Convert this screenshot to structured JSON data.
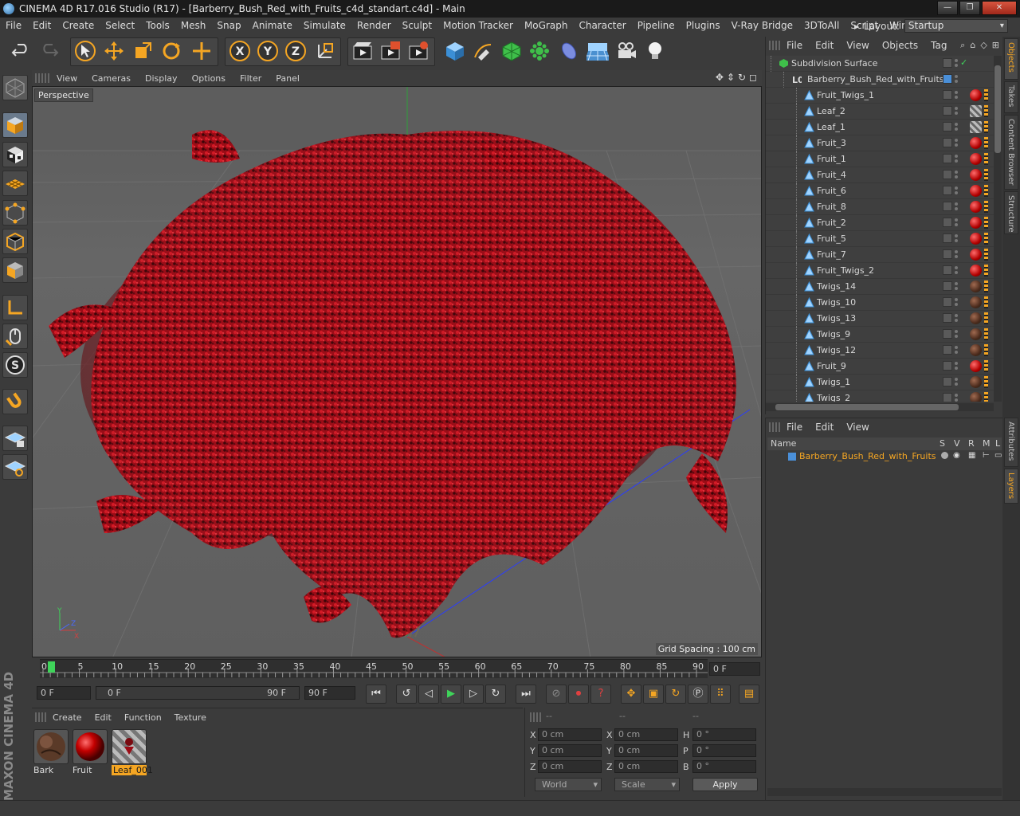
{
  "window": {
    "title": "CINEMA 4D R17.016 Studio (R17) - [Barberry_Bush_Red_with_Fruits_c4d_standart.c4d] - Main",
    "minimize": "—",
    "maximize": "❐",
    "close": "✕"
  },
  "menubar": {
    "items": [
      "File",
      "Edit",
      "Create",
      "Select",
      "Tools",
      "Mesh",
      "Snap",
      "Animate",
      "Simulate",
      "Render",
      "Sculpt",
      "Motion Tracker",
      "MoGraph",
      "Character",
      "Pipeline",
      "Plugins",
      "V-Ray Bridge",
      "3DToAll",
      "Script",
      "Window"
    ],
    "layout_label": "Layout:",
    "layout_value": "Startup"
  },
  "toolbar": {
    "axis_x": "X",
    "axis_y": "Y",
    "axis_z": "Z"
  },
  "viewport": {
    "menu": [
      "View",
      "Cameras",
      "Display",
      "Options",
      "Filter",
      "Panel"
    ],
    "label": "Perspective",
    "grid_spacing": "Grid Spacing : 100 cm"
  },
  "timeline": {
    "ticks": [
      "0",
      "5",
      "10",
      "15",
      "20",
      "25",
      "30",
      "35",
      "40",
      "45",
      "50",
      "55",
      "60",
      "65",
      "70",
      "75",
      "80",
      "85",
      "90"
    ],
    "current_frame": "0 F"
  },
  "transport": {
    "start_field": "0 F",
    "range_start": "0 F",
    "range_end": "90 F",
    "end_field": "90 F"
  },
  "material_manager": {
    "menu": [
      "Create",
      "Edit",
      "Function",
      "Texture"
    ],
    "materials": [
      {
        "name": "Bark",
        "selected": false
      },
      {
        "name": "Fruit",
        "selected": false
      },
      {
        "name": "Leaf_001",
        "selected": true
      }
    ]
  },
  "coordinates": {
    "col_headers": [
      "--",
      "--",
      "--"
    ],
    "rows": [
      {
        "l1": "X",
        "v1": "0 cm",
        "l2": "X",
        "v2": "0 cm",
        "l3": "H",
        "v3": "0 °"
      },
      {
        "l1": "Y",
        "v1": "0 cm",
        "l2": "Y",
        "v2": "0 cm",
        "l3": "P",
        "v3": "0 °"
      },
      {
        "l1": "Z",
        "v1": "0 cm",
        "l2": "Z",
        "v2": "0 cm",
        "l3": "B",
        "v3": "0 °"
      }
    ],
    "space_select": "World",
    "mode_select": "Scale",
    "apply": "Apply"
  },
  "object_manager": {
    "menu": [
      "File",
      "Edit",
      "View",
      "Objects",
      "Tag"
    ],
    "objects": [
      {
        "name": "Subdivision Surface",
        "level": 0,
        "tag": "none"
      },
      {
        "name": "Barberry_Bush_Red_with_Fruits",
        "level": 1,
        "tag": "layer"
      },
      {
        "name": "Fruit_Twigs_1",
        "level": 2,
        "tag": "fruit"
      },
      {
        "name": "Leaf_2",
        "level": 2,
        "tag": "leaf"
      },
      {
        "name": "Leaf_1",
        "level": 2,
        "tag": "leaf"
      },
      {
        "name": "Fruit_3",
        "level": 2,
        "tag": "fruit"
      },
      {
        "name": "Fruit_1",
        "level": 2,
        "tag": "fruit"
      },
      {
        "name": "Fruit_4",
        "level": 2,
        "tag": "fruit"
      },
      {
        "name": "Fruit_6",
        "level": 2,
        "tag": "fruit"
      },
      {
        "name": "Fruit_8",
        "level": 2,
        "tag": "fruit"
      },
      {
        "name": "Fruit_2",
        "level": 2,
        "tag": "fruit"
      },
      {
        "name": "Fruit_5",
        "level": 2,
        "tag": "fruit"
      },
      {
        "name": "Fruit_7",
        "level": 2,
        "tag": "fruit"
      },
      {
        "name": "Fruit_Twigs_2",
        "level": 2,
        "tag": "fruit"
      },
      {
        "name": "Twigs_14",
        "level": 2,
        "tag": "bark"
      },
      {
        "name": "Twigs_10",
        "level": 2,
        "tag": "bark"
      },
      {
        "name": "Twigs_13",
        "level": 2,
        "tag": "bark"
      },
      {
        "name": "Twigs_9",
        "level": 2,
        "tag": "bark"
      },
      {
        "name": "Twigs_12",
        "level": 2,
        "tag": "bark"
      },
      {
        "name": "Fruit_9",
        "level": 2,
        "tag": "fruit"
      },
      {
        "name": "Twigs_1",
        "level": 2,
        "tag": "bark"
      },
      {
        "name": "Twigs_2",
        "level": 2,
        "tag": "bark"
      }
    ]
  },
  "layer_manager": {
    "menu": [
      "File",
      "Edit",
      "View"
    ],
    "columns": {
      "name": "Name",
      "s": "S",
      "v": "V",
      "r": "R",
      "m": "M",
      "l": "L"
    },
    "layer_name": "Barberry_Bush_Red_with_Fruits"
  },
  "side_tabs": [
    "Objects",
    "Takes",
    "Content Browser",
    "Structure",
    "Attributes",
    "Layers"
  ],
  "branding": "MAXON CINEMA 4D",
  "colors": {
    "accent": "#f5a623",
    "foliage": "#c0151f",
    "timeline_marker": "#3fd45a"
  }
}
